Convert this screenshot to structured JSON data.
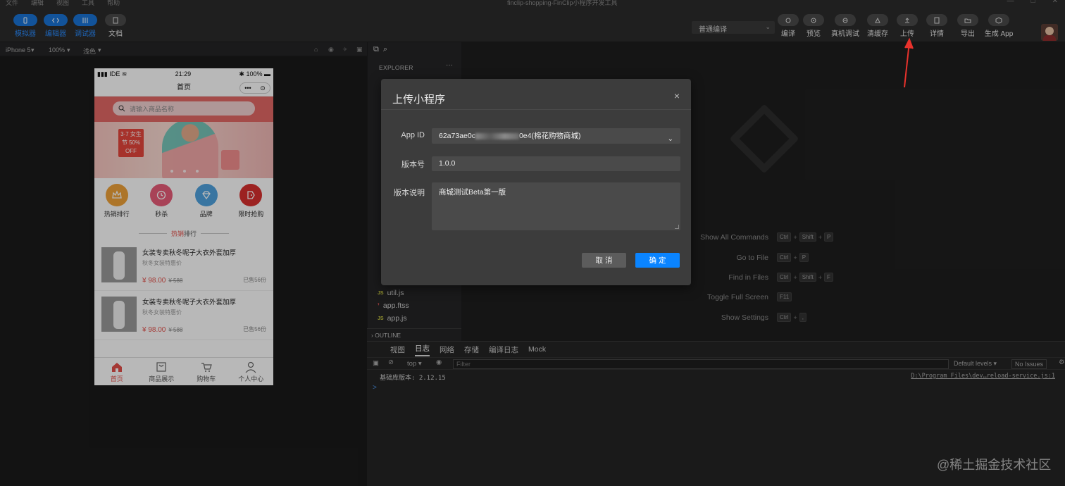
{
  "window": {
    "title": "finclip-shopping-FinClip小程序开发工具",
    "menus": [
      "文件",
      "编辑",
      "视图",
      "工具",
      "帮助"
    ],
    "controls": [
      "—",
      "□",
      "✕"
    ]
  },
  "toolbar": {
    "left": [
      {
        "label": "模拟器",
        "icon": "phone-icon"
      },
      {
        "label": "编辑器",
        "icon": "code-icon"
      },
      {
        "label": "调试器",
        "icon": "debug-icon"
      },
      {
        "label": "文档",
        "icon": "doc-icon"
      }
    ],
    "compile_mode": "普通编译",
    "right": [
      {
        "label": "编译",
        "icon": "refresh-icon"
      },
      {
        "label": "预览",
        "icon": "eye-icon"
      },
      {
        "label": "真机调试",
        "icon": "device-icon"
      },
      {
        "label": "清缓存",
        "icon": "clear-icon"
      },
      {
        "label": "上传",
        "icon": "upload-icon"
      },
      {
        "label": "详情",
        "icon": "detail-icon"
      },
      {
        "label": "导出",
        "icon": "folder-icon"
      },
      {
        "label": "生成 App",
        "icon": "box-icon"
      }
    ]
  },
  "simulator": {
    "device": "iPhone 5",
    "zoom": "100%",
    "mode": "浅色"
  },
  "phone": {
    "status": {
      "carrier": "IDE",
      "time": "21:29",
      "battery": "100%"
    },
    "nav_title": "首页",
    "capsule_more": "•••",
    "capsule_close": "⊙",
    "search_placeholder": "请输入商品名称",
    "banner_tag": "3·7 女生节 50% OFF",
    "categories": [
      {
        "label": "热销排行",
        "color": "#f0a23a",
        "icon": "crown-icon"
      },
      {
        "label": "秒杀",
        "color": "#e95c79",
        "icon": "clock-icon"
      },
      {
        "label": "品牌",
        "color": "#4fa3e0",
        "icon": "diamond-icon"
      },
      {
        "label": "限时抢购",
        "color": "#d9302e",
        "icon": "tag-icon"
      }
    ],
    "section_title_a": "热销",
    "section_title_b": "排行",
    "products": [
      {
        "name": "女装专卖秋冬呢子大衣外套加厚",
        "sub": "秋冬女装特惠价",
        "price": "¥ 98.00",
        "old": "¥ 588",
        "sold": "已售56份"
      },
      {
        "name": "女装专卖秋冬呢子大衣外套加厚",
        "sub": "秋冬女装特惠价",
        "price": "¥ 98.00",
        "old": "¥ 588",
        "sold": "已售56份"
      }
    ],
    "tabs": [
      {
        "label": "首页",
        "icon": "home-icon",
        "active": true
      },
      {
        "label": "商品展示",
        "icon": "store-icon",
        "active": false
      },
      {
        "label": "购物车",
        "icon": "cart-icon",
        "active": false
      },
      {
        "label": "个人中心",
        "icon": "user-icon",
        "active": false
      }
    ]
  },
  "explorer": {
    "header": "EXPLORER",
    "more": "···",
    "files": [
      {
        "name": "util.js",
        "type": "JS"
      },
      {
        "name": "app.ftss",
        "type": "ftss"
      },
      {
        "name": "app.js",
        "type": "JS"
      }
    ],
    "outline": "OUTLINE"
  },
  "editor": {
    "shortcuts": [
      {
        "name": "Show All Commands",
        "keys": [
          "Ctrl",
          "Shift",
          "P"
        ]
      },
      {
        "name": "Go to File",
        "keys": [
          "Ctrl",
          "P"
        ]
      },
      {
        "name": "Find in Files",
        "keys": [
          "Ctrl",
          "Shift",
          "F"
        ]
      },
      {
        "name": "Toggle Full Screen",
        "keys": [
          "F11"
        ]
      },
      {
        "name": "Show Settings",
        "keys": [
          "Ctrl",
          ","
        ]
      }
    ]
  },
  "console": {
    "tabs": [
      "视图",
      "日志",
      "网络",
      "存储",
      "编译日志",
      "Mock"
    ],
    "active_tab": "日志",
    "context": "top",
    "filter_placeholder": "Filter",
    "levels": "Default levels ▾",
    "issues": "No Issues",
    "log_text": "基础库版本: 2.12.15",
    "log_source": "D:\\Program Files\\dev…reload-service.js:1",
    "prompt": ">"
  },
  "dialog": {
    "title": "上传小程序",
    "close": "×",
    "appid_label": "App ID",
    "appid_prefix": "62a73ae0c",
    "appid_suffix": "0e4(棉花购物商城)",
    "version_label": "版本号",
    "version_value": "1.0.0",
    "desc_label": "版本说明",
    "desc_value": "商城测试Beta第一版",
    "cancel": "取 消",
    "confirm": "确 定"
  },
  "watermark": "@稀土掘金技术社区"
}
